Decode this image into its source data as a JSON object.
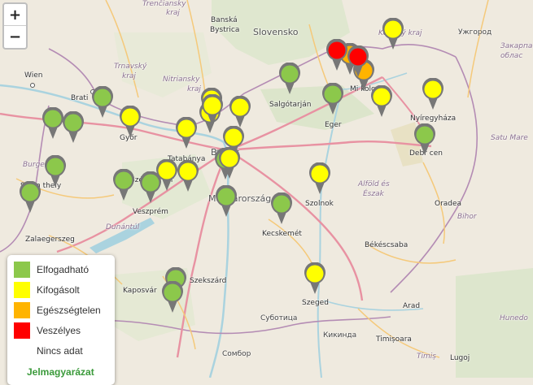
{
  "zoom": {
    "in_label": "+",
    "out_label": "−"
  },
  "labels": {
    "trencin_region": "Trenčiansky",
    "trencin_kraj": "kraj",
    "banska_bystrica": "Banská",
    "banska_bystrica2": "Bystrica",
    "slovensko": "Slovensko",
    "kosice_kraj": "Košický kraj",
    "uzhhorod": "Ужгород",
    "zakarpatska": "Закарпа",
    "zakarpatska2": "облас",
    "wien": "Wien",
    "trnava_region": "Trnavský",
    "trnava_kraj": "kraj",
    "nitra_region": "Nitriansky",
    "nitra_kraj": "kraj",
    "bratislava": "Brati",
    "salgotarjan": "Salgótarján",
    "eger": "Eger",
    "miskolc": "Mi kolc",
    "nyiregyhaza": "Nyíregyháza",
    "satu_mare": "Satu Mare",
    "tatabanya": "Tatabánya",
    "budapest": "Bu      est",
    "debrecen": "Debr   cen",
    "burgenland": "Burgenland",
    "szombathely": "Szom   thely",
    "szekesfehervar": "Szék   hérvár",
    "magyarorszag": "Magyarország",
    "veszprem": "Veszprém",
    "szolnok": "Szolnok",
    "alfold": "Alföld és",
    "alfold2": "Észak",
    "oradea": "Oradea",
    "bihor": "Bihor",
    "dunantul": "Dunántúl",
    "zalaegerszeg": "Zalaegerszeg",
    "kecskemet": "Kecskemét",
    "bekescsaba": "Békéscsaba",
    "kaposvar": "Kaposvár",
    "szekszard": "Szekszárd",
    "szeged": "Szeged",
    "arad": "Arad",
    "hunedoara": "Hunedo",
    "subotica": "Суботица",
    "kikinda": "Кикинда",
    "timisoara": "Timișoara",
    "timis": "Timiș",
    "lugoj": "Lugoj",
    "sombor": "Сомбор",
    "gyor": "Győr"
  },
  "legend": {
    "title": "Jelmagyarázat",
    "items": [
      {
        "label": "Elfogadható",
        "color": "#8cc84b"
      },
      {
        "label": "Kifogásolt",
        "color": "#ffff00"
      },
      {
        "label": "Egészségtelen",
        "color": "#ffb400"
      },
      {
        "label": "Veszélyes",
        "color": "#ff0000"
      },
      {
        "label": "Nincs adat",
        "color": "#ffffff"
      }
    ]
  },
  "stations": [
    {
      "status": "Elfogadható"
    },
    {
      "status": "Elfogadható"
    },
    {
      "status": "Elfogadható"
    },
    {
      "status": "Elfogadható"
    },
    {
      "status": "Elfogadható"
    },
    {
      "status": "Elfogadható"
    },
    {
      "status": "Elfogadható"
    },
    {
      "status": "Elfogadható"
    },
    {
      "status": "Elfogadható"
    },
    {
      "status": "Elfogadható"
    },
    {
      "status": "Elfogadható"
    },
    {
      "status": "Elfogadható"
    },
    {
      "status": "Elfogadható"
    },
    {
      "status": "Elfogadható"
    },
    {
      "status": "Elfogadható"
    },
    {
      "status": "Kifogásolt"
    },
    {
      "status": "Kifogásolt"
    },
    {
      "status": "Kifogásolt"
    },
    {
      "status": "Kifogásolt"
    },
    {
      "status": "Kifogásolt"
    },
    {
      "status": "Kifogásolt"
    },
    {
      "status": "Kifogásolt"
    },
    {
      "status": "Kifogásolt"
    },
    {
      "status": "Kifogásolt"
    },
    {
      "status": "Kifogásolt"
    },
    {
      "status": "Kifogásolt"
    },
    {
      "status": "Kifogásolt"
    },
    {
      "status": "Kifogásolt"
    },
    {
      "status": "Kifogásolt"
    },
    {
      "status": "Kifogásolt"
    },
    {
      "status": "Egészségtelen"
    },
    {
      "status": "Egészségtelen"
    },
    {
      "status": "Veszélyes"
    },
    {
      "status": "Veszélyes"
    }
  ]
}
